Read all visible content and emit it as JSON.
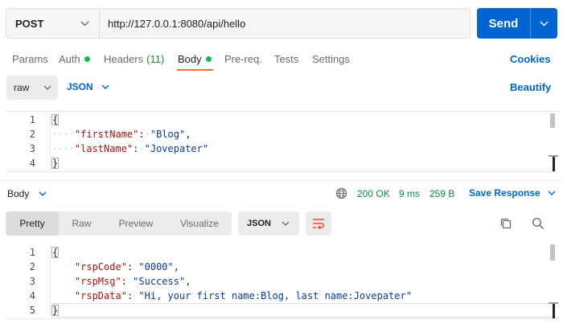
{
  "request": {
    "method": "POST",
    "url": "http://127.0.0.1:8080/api/hello",
    "send_label": "Send"
  },
  "tabs": [
    {
      "label": "Params"
    },
    {
      "label": "Auth"
    },
    {
      "label": "Headers",
      "count": "(11)"
    },
    {
      "label": "Body"
    },
    {
      "label": "Pre-req."
    },
    {
      "label": "Tests"
    },
    {
      "label": "Settings"
    }
  ],
  "cookies_label": "Cookies",
  "body_mode": "raw",
  "body_format": "JSON",
  "beautify_label": "Beautify",
  "request_body": {
    "line_numbers": [
      "1",
      "2",
      "3",
      "4"
    ],
    "open": "{",
    "close": "}",
    "k1": "\"firstName\"",
    "v1": "\"Blog\"",
    "k2": "\"lastName\"",
    "v2": "\"Jovepater\""
  },
  "response": {
    "section_label": "Body",
    "status": "200 OK",
    "time": "9 ms",
    "size": "259 B",
    "save_label": "Save Response",
    "view_tabs": [
      "Pretty",
      "Raw",
      "Preview",
      "Visualize"
    ],
    "format": "JSON",
    "line_numbers": [
      "1",
      "2",
      "3",
      "4",
      "5"
    ],
    "open": "{",
    "close": "}",
    "k1": "\"rspCode\"",
    "v1": "\"0000\"",
    "k2": "\"rspMsg\"",
    "v2": "\"Success\"",
    "k3": "\"rspData\"",
    "v3": "\"Hi, your first name:Blog, last name:Jovepater\""
  },
  "colors": {
    "accent": "#0265d2",
    "active_tab": "#ff6c37",
    "status_ok": "#0b8a3c",
    "key": "#a31515",
    "string": "#0a3c97"
  },
  "icons": [
    "chevron-down-icon",
    "globe-icon",
    "wrap-lines-icon",
    "copy-icon",
    "search-icon"
  ]
}
